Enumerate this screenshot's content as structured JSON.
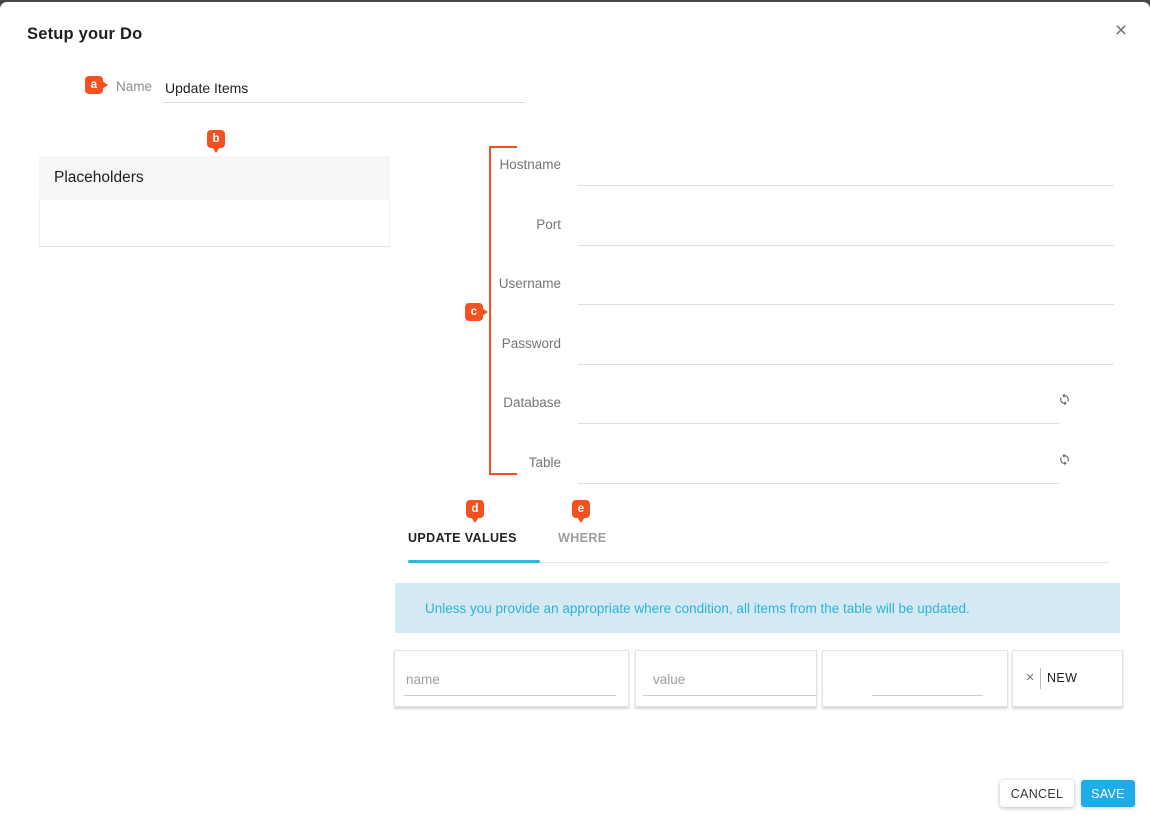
{
  "dialog": {
    "title": "Setup your Do",
    "close_icon": "×"
  },
  "markers": {
    "a": "a",
    "b": "b",
    "c": "c",
    "d": "d",
    "e": "e"
  },
  "name_field": {
    "label": "Name",
    "value": "Update Items"
  },
  "placeholders_panel": {
    "title": "Placeholders"
  },
  "connection_fields": [
    {
      "label": "Hostname",
      "value": ""
    },
    {
      "label": "Port",
      "value": ""
    },
    {
      "label": "Username",
      "value": ""
    },
    {
      "label": "Password",
      "value": ""
    },
    {
      "label": "Database",
      "value": ""
    },
    {
      "label": "Table",
      "value": ""
    }
  ],
  "tabs": [
    {
      "label": "UPDATE VALUES",
      "active": true
    },
    {
      "label": "WHERE",
      "active": false
    }
  ],
  "banner": {
    "text": "Unless you provide an appropriate where condition, all items from the table will be updated."
  },
  "update_values_row": {
    "name_input": {
      "placeholder": "name",
      "value": ""
    },
    "value_input": {
      "placeholder": "value",
      "value": ""
    },
    "extra_input": {
      "value": ""
    },
    "new_button": {
      "label": "NEW",
      "close_icon": "×"
    }
  },
  "footer": {
    "cancel_label": "CANCEL",
    "save_label": "SAVE"
  },
  "colors": {
    "accent_orange": "#f4511e",
    "tab_ink_cyan": "#2cb9d8",
    "save_blue": "#1eade9",
    "banner_bg": "#d4e9f2",
    "banner_text": "#2bb3d7"
  }
}
